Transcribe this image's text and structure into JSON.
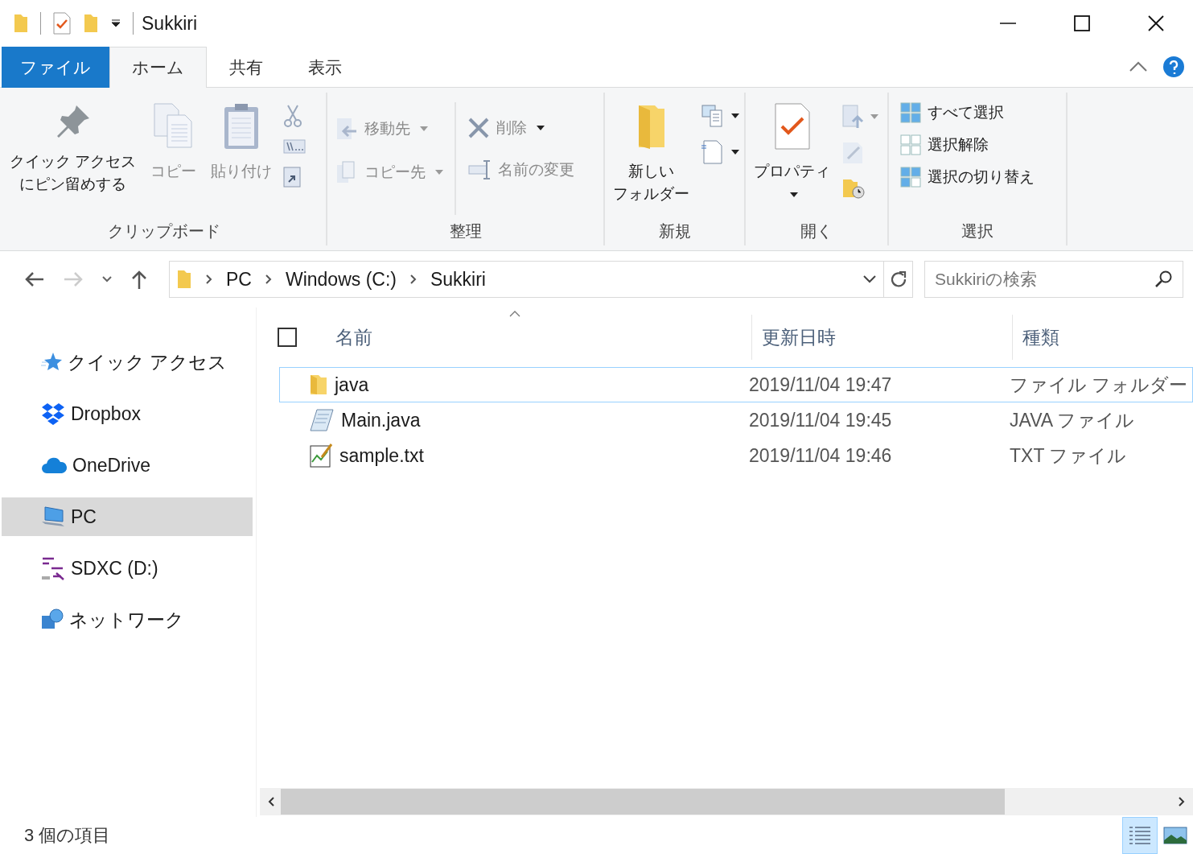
{
  "window": {
    "title": "Sukkiri"
  },
  "tabs": [
    {
      "label": "ファイル",
      "kind": "file",
      "selected": false
    },
    {
      "label": "ホーム",
      "kind": "tab",
      "selected": true
    },
    {
      "label": "共有",
      "kind": "tab",
      "selected": false
    },
    {
      "label": "表示",
      "kind": "tab",
      "selected": false
    }
  ],
  "ribbon": {
    "groups": [
      {
        "label": "クリップボード",
        "buttons": [
          {
            "lines": [
              "クイック アクセス",
              "にピン留めする"
            ],
            "disabled": false
          },
          {
            "label": "コピー",
            "disabled": true
          },
          {
            "label": "貼り付け",
            "disabled": true
          }
        ]
      },
      {
        "label": "整理",
        "buttons": [
          {
            "label": "移動先",
            "disabled": true,
            "dropdown": true
          },
          {
            "label": "コピー先",
            "disabled": true,
            "dropdown": true
          },
          {
            "label": "削除",
            "disabled": true,
            "dropdown": true
          },
          {
            "label": "名前の変更",
            "disabled": true,
            "dropdown": false
          }
        ]
      },
      {
        "label": "新規",
        "buttons": [
          {
            "lines": [
              "新しい",
              "フォルダー"
            ],
            "disabled": false
          }
        ]
      },
      {
        "label": "開く",
        "buttons": [
          {
            "label": "プロパティ",
            "disabled": false,
            "dropdown": true
          }
        ]
      },
      {
        "label": "選択",
        "buttons": [
          {
            "label": "すべて選択",
            "disabled": false
          },
          {
            "label": "選択解除",
            "disabled": false
          },
          {
            "label": "選択の切り替え",
            "disabled": false
          }
        ]
      }
    ]
  },
  "address": {
    "crumbs": [
      "PC",
      "Windows (C:)",
      "Sukkiri"
    ]
  },
  "search": {
    "placeholder": "Sukkiriの検索"
  },
  "sidebar": {
    "items": [
      {
        "label": "クイック アクセス",
        "kind": "quick",
        "selected": false
      },
      {
        "label": "Dropbox",
        "kind": "dropbox",
        "selected": false
      },
      {
        "label": "OneDrive",
        "kind": "onedrive",
        "selected": false
      },
      {
        "label": "PC",
        "kind": "pc",
        "selected": true
      },
      {
        "label": "SDXC (D:)",
        "kind": "sd",
        "selected": false
      },
      {
        "label": "ネットワーク",
        "kind": "network",
        "selected": false
      }
    ]
  },
  "table": {
    "select_all": {
      "checked": false
    },
    "columns": [
      "名前",
      "更新日時",
      "種類"
    ],
    "rows": [
      {
        "name": "java",
        "date": "2019/11/04 19:47",
        "type": "ファイル フォルダー",
        "kind": "folder",
        "focused": true
      },
      {
        "name": "Main.java",
        "date": "2019/11/04 19:45",
        "type": "JAVA ファイル",
        "kind": "java",
        "focused": false
      },
      {
        "name": "sample.txt",
        "date": "2019/11/04 19:46",
        "type": "TXT ファイル",
        "kind": "text",
        "focused": false
      }
    ]
  },
  "status_bar": {
    "count": "3 個の項目",
    "views": [
      {
        "kind": "details",
        "selected": true
      },
      {
        "kind": "tiles",
        "selected": false
      }
    ]
  }
}
